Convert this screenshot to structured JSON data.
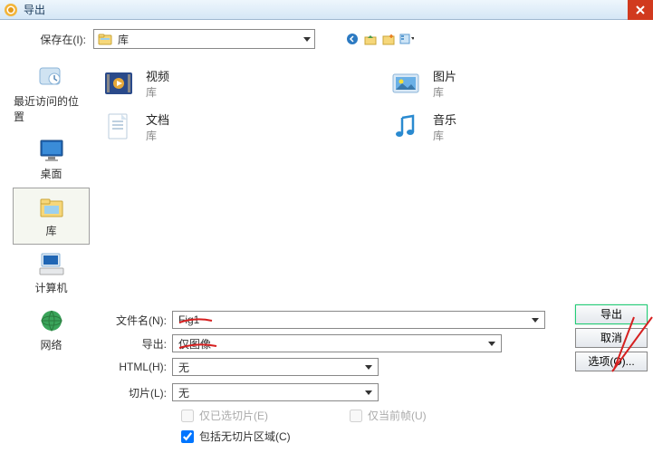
{
  "titlebar": {
    "title": "导出"
  },
  "toolbar": {
    "save_in_label": "保存在(I):",
    "location": "库"
  },
  "places": [
    {
      "label": "最近访问的位置"
    },
    {
      "label": "桌面"
    },
    {
      "label": "库"
    },
    {
      "label": "计算机"
    },
    {
      "label": "网络"
    }
  ],
  "libraries": [
    {
      "name": "视频",
      "sub": "库"
    },
    {
      "name": "图片",
      "sub": "库"
    },
    {
      "name": "文档",
      "sub": "库"
    },
    {
      "name": "音乐",
      "sub": "库"
    }
  ],
  "form": {
    "filename_label": "文件名(N):",
    "filename_value": "Fig1",
    "export_label": "导出:",
    "export_value": "仅图像",
    "html_label": "HTML(H):",
    "html_value": "无",
    "slice_label": "切片(L):",
    "slice_value": "无",
    "chk_selected_slices": "仅已选切片(E)",
    "chk_current_frame": "仅当前帧(U)",
    "chk_include_areas": "包括无切片区域(C)"
  },
  "buttons": {
    "export": "导出",
    "cancel": "取消",
    "options": "选项(O)..."
  }
}
